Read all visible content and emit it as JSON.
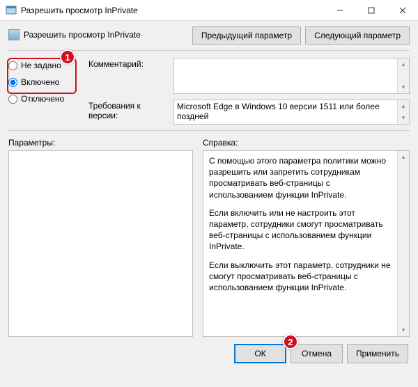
{
  "titlebar": {
    "title": "Разрешить просмотр InPrivate"
  },
  "header": {
    "policy_title": "Разрешить просмотр InPrivate",
    "prev_button": "Предыдущий параметр",
    "next_button": "Следующий параметр"
  },
  "radios": {
    "not_configured": "Не задано",
    "enabled": "Включено",
    "disabled": "Отключено"
  },
  "labels": {
    "comment": "Комментарий:",
    "requirements": "Требования к версии:",
    "parameters": "Параметры:",
    "help": "Справка:"
  },
  "values": {
    "requirements": "Microsoft Edge в Windows 10 версии 1511 или более поздней"
  },
  "help": {
    "p1": "С помощью этого параметра политики можно разрешить или запретить сотрудникам просматривать веб-страницы с использованием функции InPrivate.",
    "p2": "Если включить или не настроить этот параметр, сотрудники смогут просматривать веб-страницы с использованием функции InPrivate.",
    "p3": "Если выключить этот параметр, сотрудники не смогут просматривать веб-страницы с использованием функции InPrivate."
  },
  "footer": {
    "ok": "ОК",
    "cancel": "Отмена",
    "apply": "Применить"
  },
  "annotations": {
    "badge1": "1",
    "badge2": "2"
  }
}
